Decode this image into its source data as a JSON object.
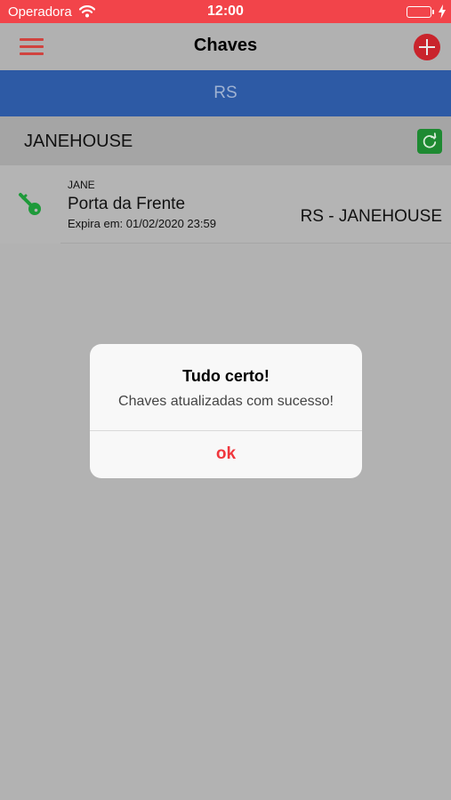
{
  "status_bar": {
    "carrier": "Operadora",
    "time": "12:00",
    "wifi_icon": "wifi-icon",
    "battery_icon": "battery-icon",
    "charging_icon": "charging-bolt-icon"
  },
  "nav": {
    "title": "Chaves",
    "menu_icon": "hamburger-menu-icon",
    "add_icon": "plus-circle-icon"
  },
  "region_tab": {
    "label": "RS"
  },
  "group": {
    "name": "JANEHOUSE",
    "refresh_icon": "refresh-icon"
  },
  "keys": [
    {
      "owner": "JANE",
      "name": "Porta da Frente",
      "expiry": "Expira em: 01/02/2020 23:59",
      "location": "RS - JANEHOUSE",
      "icon": "key-icon"
    }
  ],
  "alert": {
    "title": "Tudo certo!",
    "message": "Chaves atualizadas com sucesso!",
    "ok_label": "ok"
  },
  "colors": {
    "status_bar": "#f2444a",
    "nav_accent": "#d0433f",
    "add_button": "#c9242c",
    "region_tab": "#2d5aa5",
    "refresh_button": "#1e8a32",
    "key_icon": "#1e9a3a",
    "alert_ok": "#f0373d"
  }
}
